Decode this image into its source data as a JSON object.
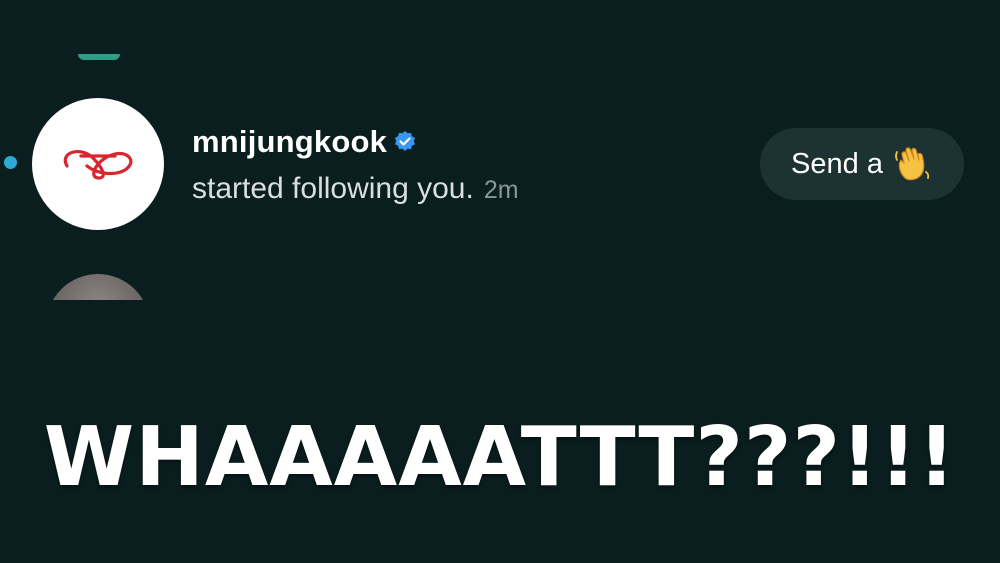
{
  "notification": {
    "username": "mnijungkook",
    "activity": "started following you.",
    "timestamp": "2m",
    "verified": true,
    "send_button_label": "Send a",
    "send_button_icon": "waving-hand-icon"
  },
  "caption": {
    "text": "WHAAAAATTT???!!!"
  },
  "colors": {
    "background": "#0b1e1f",
    "unread_dot": "#2fa8d6",
    "verified_badge": "#3897f0",
    "avatar_logo": "#d8262f",
    "button_bg": "#1d3232"
  }
}
